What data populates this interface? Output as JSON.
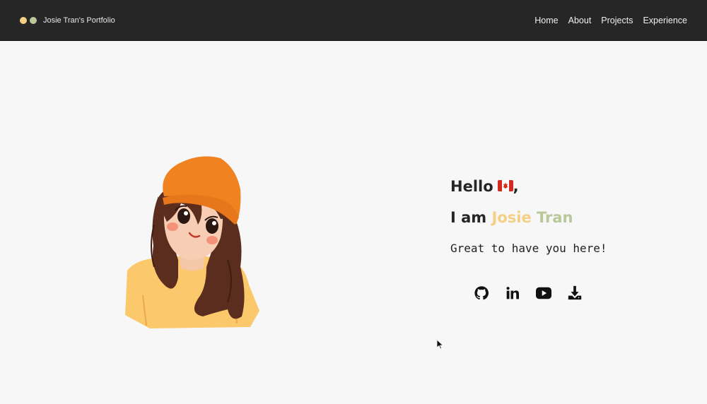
{
  "nav": {
    "brand": "Josie Tran's Portfolio",
    "links": [
      "Home",
      "About",
      "Projects",
      "Experience"
    ]
  },
  "hero": {
    "hello": "Hello",
    "hello_suffix": ",",
    "i_am": "I am",
    "first_name": "Josie",
    "last_name": "Tran",
    "tagline": "Great to have you here!"
  },
  "social_icons": [
    "github-icon",
    "linkedin-icon",
    "youtube-icon",
    "download-icon"
  ],
  "colors": {
    "nav_bg": "#262626",
    "accent_yellow": "#f5cf84",
    "accent_green": "#b9c79a",
    "page_bg": "#f7f7f7"
  }
}
